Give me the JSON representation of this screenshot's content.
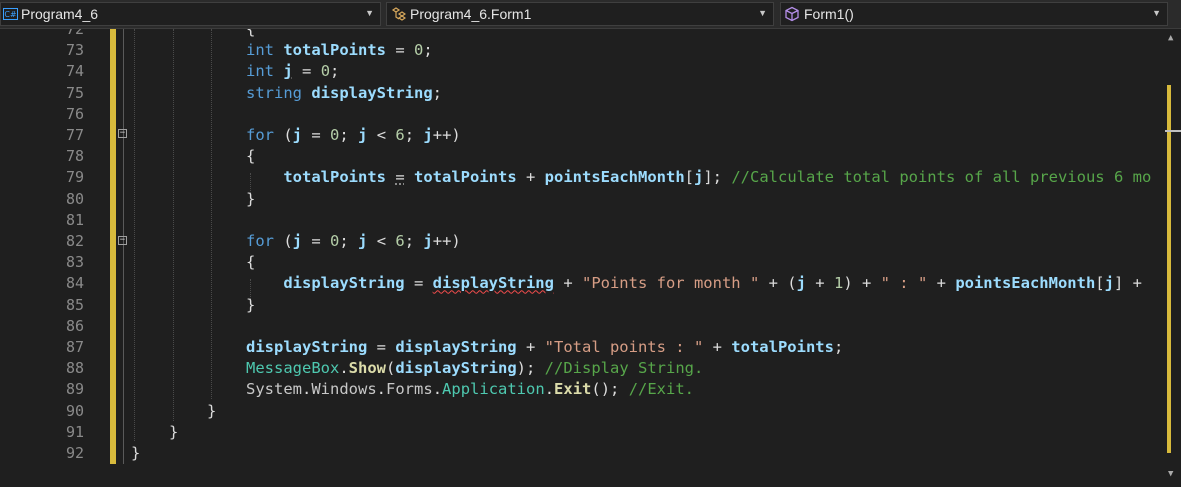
{
  "navbar": {
    "project": "Program4_6",
    "class": "Program4_6.Form1",
    "member": "Form1()",
    "icons": [
      "csharp-project-icon",
      "class-icon",
      "method-cube-icon"
    ]
  },
  "colors": {
    "keyword": "#569cd6",
    "identifier": "#9cdcfe",
    "comment": "#57a64a",
    "string": "#d69d85",
    "number": "#b5cea8",
    "type": "#4ec9b0",
    "method": "#dcdcaa",
    "change_marker": "#d7ba3c"
  },
  "lines": [
    {
      "n": "72",
      "t": [
        {
          "c": "pl",
          "v": "{"
        }
      ]
    },
    {
      "n": "73",
      "t": [
        {
          "c": "kw",
          "v": "int"
        },
        {
          "c": "pl",
          "v": " "
        },
        {
          "c": "id",
          "v": "totalPoints"
        },
        {
          "c": "pl",
          "v": " = "
        },
        {
          "c": "num",
          "v": "0"
        },
        {
          "c": "pl",
          "v": ";"
        }
      ]
    },
    {
      "n": "74",
      "t": [
        {
          "c": "kw",
          "v": "int"
        },
        {
          "c": "pl",
          "v": " "
        },
        {
          "c": "id dots",
          "v": "j"
        },
        {
          "c": "pl",
          "v": " = "
        },
        {
          "c": "num",
          "v": "0"
        },
        {
          "c": "pl",
          "v": ";"
        }
      ]
    },
    {
      "n": "75",
      "t": [
        {
          "c": "kw",
          "v": "string"
        },
        {
          "c": "pl",
          "v": " "
        },
        {
          "c": "id",
          "v": "displayString"
        },
        {
          "c": "pl",
          "v": ";"
        }
      ]
    },
    {
      "n": "76",
      "t": []
    },
    {
      "n": "77",
      "t": [
        {
          "c": "kw",
          "v": "for"
        },
        {
          "c": "pl",
          "v": " ("
        },
        {
          "c": "id",
          "v": "j"
        },
        {
          "c": "pl",
          "v": " = "
        },
        {
          "c": "num",
          "v": "0"
        },
        {
          "c": "pl",
          "v": "; "
        },
        {
          "c": "id",
          "v": "j"
        },
        {
          "c": "pl",
          "v": " < "
        },
        {
          "c": "num",
          "v": "6"
        },
        {
          "c": "pl",
          "v": "; "
        },
        {
          "c": "id",
          "v": "j"
        },
        {
          "c": "pl",
          "v": "++)"
        }
      ]
    },
    {
      "n": "78",
      "t": [
        {
          "c": "pl",
          "v": "{"
        }
      ]
    },
    {
      "n": "79",
      "t": [
        {
          "c": "pl",
          "v": "    "
        },
        {
          "c": "id",
          "v": "totalPoints"
        },
        {
          "c": "pl",
          "v": " "
        },
        {
          "c": "pl dots",
          "v": "="
        },
        {
          "c": "pl",
          "v": " "
        },
        {
          "c": "id",
          "v": "totalPoints"
        },
        {
          "c": "pl",
          "v": " + "
        },
        {
          "c": "id",
          "v": "pointsEachMonth"
        },
        {
          "c": "pl",
          "v": "["
        },
        {
          "c": "id",
          "v": "j"
        },
        {
          "c": "pl",
          "v": "]; "
        },
        {
          "c": "cm",
          "v": "//Calculate total points of all previous 6 mo"
        }
      ]
    },
    {
      "n": "80",
      "t": [
        {
          "c": "pl",
          "v": "}"
        }
      ]
    },
    {
      "n": "81",
      "t": []
    },
    {
      "n": "82",
      "t": [
        {
          "c": "kw",
          "v": "for"
        },
        {
          "c": "pl",
          "v": " ("
        },
        {
          "c": "id",
          "v": "j"
        },
        {
          "c": "pl",
          "v": " = "
        },
        {
          "c": "num",
          "v": "0"
        },
        {
          "c": "pl",
          "v": "; "
        },
        {
          "c": "id",
          "v": "j"
        },
        {
          "c": "pl",
          "v": " < "
        },
        {
          "c": "num",
          "v": "6"
        },
        {
          "c": "pl",
          "v": "; "
        },
        {
          "c": "id",
          "v": "j"
        },
        {
          "c": "pl",
          "v": "++)"
        }
      ]
    },
    {
      "n": "83",
      "t": [
        {
          "c": "pl",
          "v": "{"
        }
      ]
    },
    {
      "n": "84",
      "t": [
        {
          "c": "pl",
          "v": "    "
        },
        {
          "c": "id",
          "v": "displayString"
        },
        {
          "c": "pl",
          "v": " = "
        },
        {
          "c": "id squiggle",
          "v": "displayString"
        },
        {
          "c": "pl",
          "v": " + "
        },
        {
          "c": "st",
          "v": "\"Points for month \""
        },
        {
          "c": "pl",
          "v": " + ("
        },
        {
          "c": "id",
          "v": "j"
        },
        {
          "c": "pl",
          "v": " + "
        },
        {
          "c": "num",
          "v": "1"
        },
        {
          "c": "pl",
          "v": ") + "
        },
        {
          "c": "st",
          "v": "\" : \""
        },
        {
          "c": "pl",
          "v": " + "
        },
        {
          "c": "id",
          "v": "pointsEachMonth"
        },
        {
          "c": "pl",
          "v": "["
        },
        {
          "c": "id",
          "v": "j"
        },
        {
          "c": "pl",
          "v": "] +"
        }
      ]
    },
    {
      "n": "85",
      "t": [
        {
          "c": "pl",
          "v": "}"
        }
      ]
    },
    {
      "n": "86",
      "t": []
    },
    {
      "n": "87",
      "t": [
        {
          "c": "id",
          "v": "displayString"
        },
        {
          "c": "pl",
          "v": " = "
        },
        {
          "c": "id",
          "v": "displayString"
        },
        {
          "c": "pl",
          "v": " + "
        },
        {
          "c": "st",
          "v": "\"Total points : \""
        },
        {
          "c": "pl",
          "v": " + "
        },
        {
          "c": "id",
          "v": "totalPoints"
        },
        {
          "c": "pl",
          "v": ";"
        }
      ]
    },
    {
      "n": "88",
      "t": [
        {
          "c": "ty",
          "v": "MessageBox"
        },
        {
          "c": "pl",
          "v": "."
        },
        {
          "c": "fn",
          "v": "Show"
        },
        {
          "c": "pl",
          "v": "("
        },
        {
          "c": "id",
          "v": "displayString"
        },
        {
          "c": "pl",
          "v": "); "
        },
        {
          "c": "cm",
          "v": "//Display String."
        }
      ]
    },
    {
      "n": "89",
      "t": [
        {
          "c": "ns",
          "v": "System"
        },
        {
          "c": "pl",
          "v": "."
        },
        {
          "c": "ns",
          "v": "Windows"
        },
        {
          "c": "pl",
          "v": "."
        },
        {
          "c": "ns",
          "v": "Forms"
        },
        {
          "c": "pl",
          "v": "."
        },
        {
          "c": "ty",
          "v": "Application"
        },
        {
          "c": "pl",
          "v": "."
        },
        {
          "c": "fn",
          "v": "Exit"
        },
        {
          "c": "pl",
          "v": "(); "
        },
        {
          "c": "cm",
          "v": "//Exit."
        }
      ]
    },
    {
      "n": "90",
      "t": [
        {
          "c": "pl",
          "v": "}"
        }
      ]
    },
    {
      "n": "91",
      "t": [
        {
          "c": "pl",
          "v": "}"
        }
      ]
    },
    {
      "n": "92",
      "t": [
        {
          "c": "pl",
          "v": "}"
        }
      ]
    }
  ]
}
